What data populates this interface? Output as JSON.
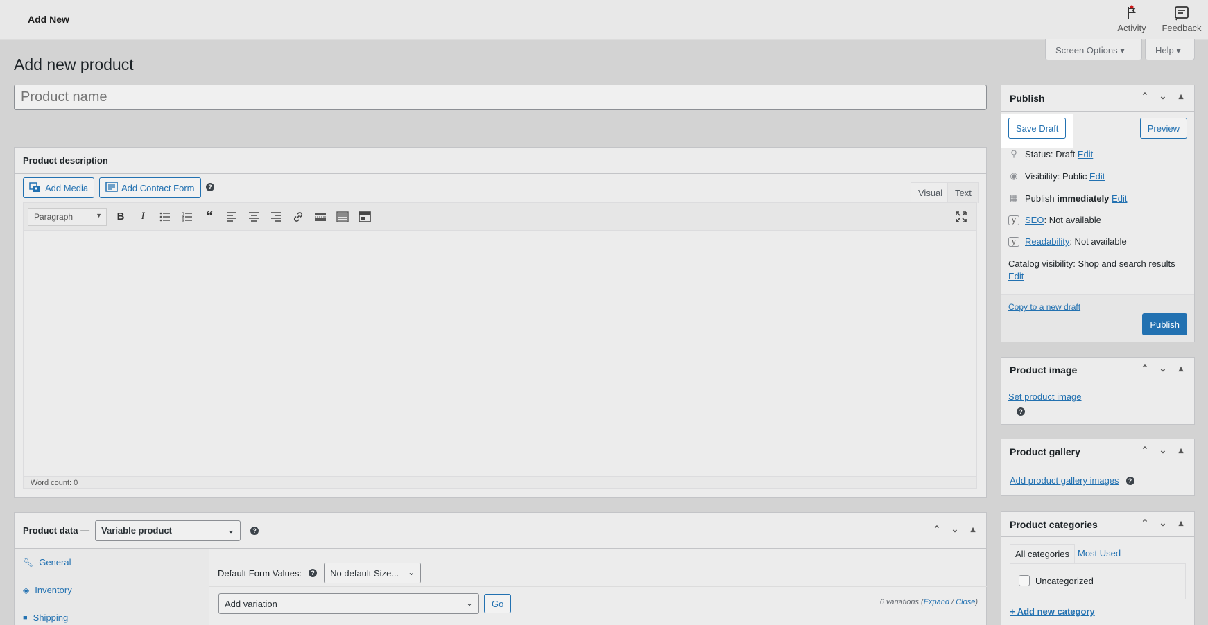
{
  "topbar": {
    "title": "Add New",
    "activity": "Activity",
    "feedback": "Feedback"
  },
  "screen_options": "Screen Options",
  "help": "Help",
  "page_title": "Add new product",
  "product_name_placeholder": "Product name",
  "description": {
    "title": "Product description",
    "add_media": "Add Media",
    "add_contact_form": "Add Contact Form",
    "tab_visual": "Visual",
    "tab_text": "Text",
    "format": "Paragraph",
    "word_count": "Word count: 0"
  },
  "publish": {
    "title": "Publish",
    "save_draft": "Save Draft",
    "preview": "Preview",
    "status_label": "Status:",
    "status_value": "Draft",
    "visibility_label": "Visibility:",
    "visibility_value": "Public",
    "publish_label": "Publish",
    "publish_value": "immediately",
    "edit": "Edit",
    "seo_link": "SEO",
    "seo_value": ": Not available",
    "readability_link": "Readability",
    "readability_value": ": Not available",
    "catalog_label": "Catalog visibility:",
    "catalog_value": "Shop and search results",
    "copy_draft": "Copy to a new draft",
    "publish_button": "Publish"
  },
  "product_image": {
    "title": "Product image",
    "link": "Set product image"
  },
  "product_gallery": {
    "title": "Product gallery",
    "link": "Add product gallery images"
  },
  "product_categories": {
    "title": "Product categories",
    "tab_all": "All categories",
    "tab_most_used": "Most Used",
    "item": "Uncategorized",
    "add_new": "+ Add new category"
  },
  "product_data": {
    "title": "Product data —",
    "type": "Variable product",
    "tabs": [
      "General",
      "Inventory",
      "Shipping"
    ],
    "default_form_values": "Default Form Values:",
    "default_size": "No default Size...",
    "add_variation": "Add variation",
    "go": "Go",
    "variations_count": "6 variations",
    "expand": "Expand",
    "close": "Close"
  }
}
